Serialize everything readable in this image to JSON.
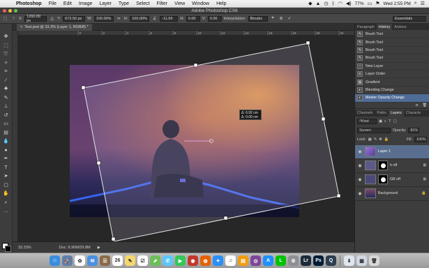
{
  "menubar": {
    "app_name": "Photoshop",
    "items": [
      "File",
      "Edit",
      "Image",
      "Layer",
      "Type",
      "Select",
      "Filter",
      "View",
      "Window",
      "Help"
    ],
    "battery": "77%",
    "clock": "Wed 2:55 PM"
  },
  "window_title": "Adobe Photoshop CS6",
  "options": {
    "x_label": "X:",
    "x_value": "1260.89 px",
    "y_label": "Y:",
    "y_value": "673.50 px",
    "w_label": "W:",
    "w_value": "100.00%",
    "h_label": "H:",
    "h_value": "100.00%",
    "angle_value": "-11.06",
    "hskew_label": "H:",
    "hskew_value": "0.00",
    "vskew_label": "V:",
    "vskew_value": "0.00",
    "interp_label": "Interpolation:",
    "interp_value": "Bicubic",
    "workspace": "Essentials"
  },
  "document_tab": {
    "title": "Test.psd @ 33.3% (Layer 1, RGB/8) *"
  },
  "ruler_ticks": [
    "0",
    "2",
    "4",
    "6",
    "8",
    "10",
    "12",
    "14",
    "16",
    "18",
    "20",
    "22"
  ],
  "transform_readout": {
    "line1": "Δ: 6.92 cm",
    "line2": "Δ: 0.00 cm"
  },
  "status": {
    "zoom": "33.33%",
    "doc": "Doc: 8.90M/29.8M"
  },
  "history_panel": {
    "tabs": [
      "Paragraph",
      "History",
      "Actions"
    ],
    "active_tab": "History",
    "items": [
      "Brush Tool",
      "Brush Tool",
      "Brush Tool",
      "Brush Tool",
      "New Layer",
      "Layer Order",
      "Gradient",
      "Blending Change",
      "Master Opacity Change"
    ]
  },
  "layers_panel": {
    "tabs": [
      "Channels",
      "Paths",
      "Layers",
      "Characte"
    ],
    "active_tab": "Layers",
    "kind_label": "Kind",
    "blend_mode": "Screen",
    "opacity_label": "Opacity:",
    "opacity_value": "81%",
    "lock_label": "Lock:",
    "fill_label": "Fill:",
    "fill_value": "100%",
    "layers": [
      "Layer 1",
      "h off",
      "GB off",
      "Background"
    ]
  },
  "dock": {
    "apps": [
      {
        "icon": "finder-icon",
        "color": "#3b8de0",
        "glyph": "☺"
      },
      {
        "icon": "launchpad-icon",
        "color": "#5f7fa8",
        "glyph": "🚀"
      },
      {
        "icon": "photos-icon",
        "color": "#ffffff",
        "glyph": "✿"
      },
      {
        "icon": "mail-icon",
        "color": "#4a90e2",
        "glyph": "✉"
      },
      {
        "icon": "contacts-icon",
        "color": "#8b6a4a",
        "glyph": "☰"
      },
      {
        "icon": "calendar-icon",
        "color": "#ffffff",
        "glyph": "26"
      },
      {
        "icon": "notes-icon",
        "color": "#f5d76e",
        "glyph": "✎"
      },
      {
        "icon": "reminders-icon",
        "color": "#ffffff",
        "glyph": "☑"
      },
      {
        "icon": "maps-icon",
        "color": "#6bbf59",
        "glyph": "⬈"
      },
      {
        "icon": "messages-icon",
        "color": "#5ac8fa",
        "glyph": "✆"
      },
      {
        "icon": "facetime-icon",
        "color": "#34c759",
        "glyph": "▶"
      },
      {
        "icon": "photo-booth-icon",
        "color": "#c0392b",
        "glyph": "◉"
      },
      {
        "icon": "firefox-icon",
        "color": "#e66000",
        "glyph": "◍"
      },
      {
        "icon": "safari-icon",
        "color": "#2a8ff7",
        "glyph": "✦"
      },
      {
        "icon": "itunes-icon",
        "color": "#ffffff",
        "glyph": "♫"
      },
      {
        "icon": "ibooks-icon",
        "color": "#f39c12",
        "glyph": "▤"
      },
      {
        "icon": "tor-icon",
        "color": "#7d4698",
        "glyph": "◎"
      },
      {
        "icon": "app-store-icon",
        "color": "#1e90ff",
        "glyph": "A"
      },
      {
        "icon": "line-icon",
        "color": "#00c300",
        "glyph": "L"
      },
      {
        "icon": "system-prefs-icon",
        "color": "#8e8e93",
        "glyph": "⚙"
      },
      {
        "icon": "lightroom-icon",
        "color": "#1b2b3a",
        "glyph": "Lr"
      },
      {
        "icon": "photoshop-icon",
        "color": "#001d34",
        "glyph": "Ps"
      },
      {
        "icon": "quicktime-icon",
        "color": "#2c3e50",
        "glyph": "Q"
      },
      {
        "icon": "downloads-icon",
        "color": "#dfe6ee",
        "glyph": "⬇"
      },
      {
        "icon": "documents-icon",
        "color": "#cfd8e3",
        "glyph": "▦"
      },
      {
        "icon": "trash-icon",
        "color": "#d7d7d7",
        "glyph": "🗑"
      }
    ]
  }
}
